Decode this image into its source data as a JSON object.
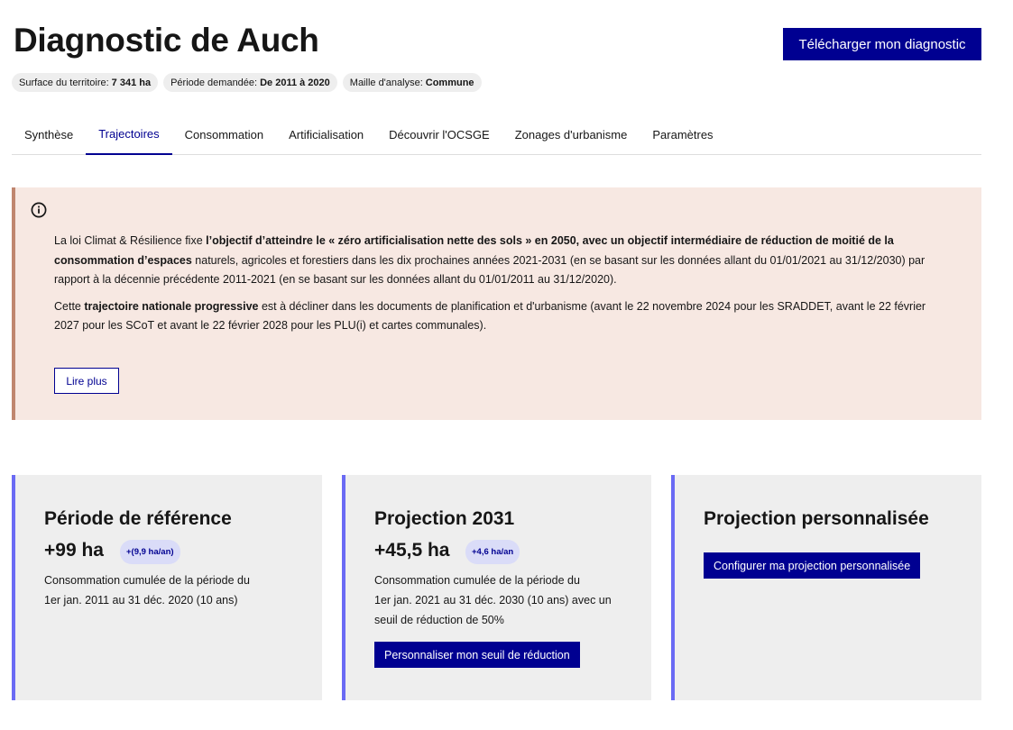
{
  "header": {
    "title": "Diagnostic de Auch",
    "download_label": "Télécharger mon diagnostic"
  },
  "tags": [
    {
      "label": "Surface du territoire:",
      "value": "7 341 ha"
    },
    {
      "label": "Période demandée:",
      "value": "De 2011 à 2020"
    },
    {
      "label": "Maille d'analyse:",
      "value": "Commune"
    }
  ],
  "tabs": [
    {
      "label": "Synthèse"
    },
    {
      "label": "Trajectoires",
      "active": true
    },
    {
      "label": "Consommation"
    },
    {
      "label": "Artificialisation"
    },
    {
      "label": "Découvrir l'OCSGE"
    },
    {
      "label": "Zonages d'urbanisme"
    },
    {
      "label": "Paramètres"
    }
  ],
  "callout": {
    "icon": "info-icon",
    "p1_a": "La loi Climat & Résilience fixe ",
    "p1_bold": "l’objectif d’atteindre le « zéro artificialisation nette des sols » en 2050, avec un objectif intermédiaire de réduction de moitié de la consommation d’espaces",
    "p1_b": " naturels, agricoles et forestiers dans les dix prochaines années 2021-2031 (en se basant sur les données allant du 01/01/2021 au 31/12/2030) par rapport à la décennie précédente 2011-2021 (en se basant sur les données allant du 01/01/2011 au 31/12/2020).",
    "p2_a": "Cette ",
    "p2_bold": "trajectoire nationale progressive",
    "p2_b": " est à décliner dans les documents de planification et d'urbanisme (avant le 22 novembre 2024 pour les SRADDET, avant le 22 février 2027 pour les SCoT et avant le 22 février 2028 pour les PLU(i) et cartes communales).",
    "read_more": "Lire plus"
  },
  "cards": [
    {
      "title": "Période de référence",
      "value": "+99 ha",
      "badge": "+(9,9 ha/an)",
      "desc_line1": "Consommation cumulée de la période du",
      "desc_line2": "1er jan. 2011 au 31 déc. 2020 (10 ans)"
    },
    {
      "title": "Projection 2031",
      "value": "+45,5 ha",
      "badge": "+4,6 ha/an",
      "desc_line1": "Consommation cumulée de la période du",
      "desc_line2": "1er jan. 2021 au 31 déc. 2030 (10 ans) avec un",
      "desc_line3": "seuil de réduction de 50%",
      "button": "Personnaliser mon seuil de réduction"
    },
    {
      "title": "Projection personnalisée",
      "button": "Configurer ma projection personnalisée"
    }
  ],
  "colors": {
    "primary": "#000091",
    "callout_bg": "#f7e8e2",
    "callout_border": "#c0866f",
    "card_bg": "#eeeeee",
    "card_accent": "#6a6af4",
    "badge_bg": "#dadcf8"
  }
}
